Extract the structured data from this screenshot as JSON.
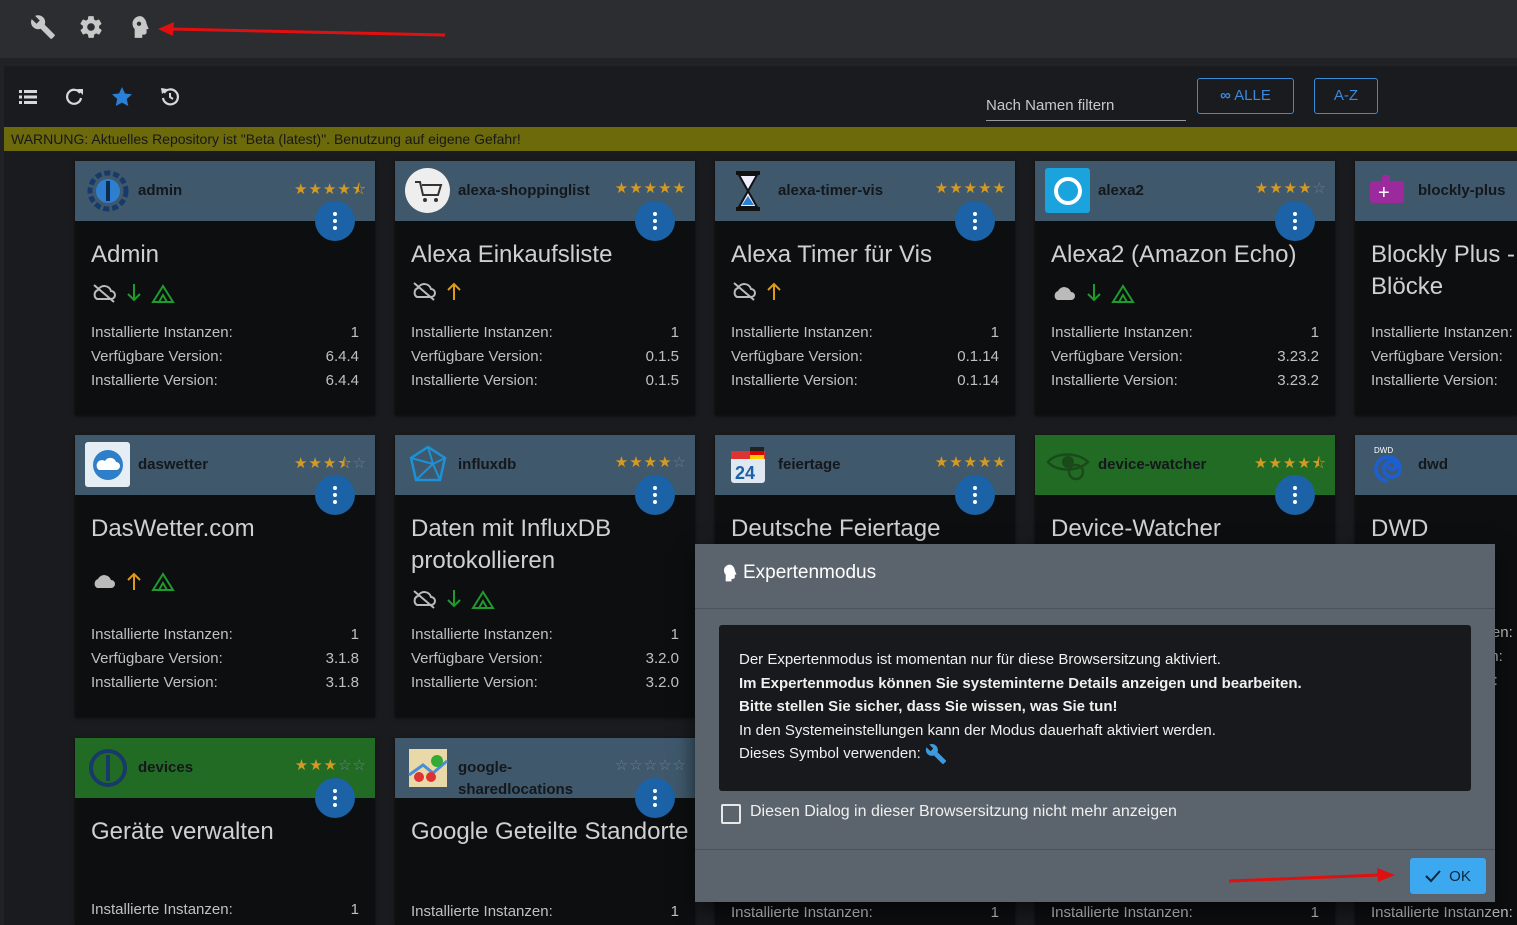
{
  "topbar": {
    "icons": [
      "wrench-icon",
      "gear-icon",
      "expert-head-icon"
    ]
  },
  "toolbar": {
    "icons": [
      "list-view-icon",
      "refresh-icon",
      "star-icon",
      "update-icon"
    ],
    "filter_placeholder": "Nach Namen filtern",
    "all_label": "ALLE",
    "az_label": "A-Z"
  },
  "warning": "WARNUNG: Aktuelles Repository ist \"Beta (latest)\". Benutzung auf eigene Gefahr!",
  "labels": {
    "instances": "Installierte Instanzen:",
    "available": "Verfügbare Version:",
    "installed": "Installierte Version:"
  },
  "cards": [
    {
      "name": "admin",
      "title": "Admin",
      "stars": "★★★★⯪",
      "instances": "1",
      "available": "6.4.4",
      "installed": "6.4.4"
    },
    {
      "name": "alexa-shoppinglist",
      "title": "Alexa Einkaufsliste",
      "stars": "★★★★★",
      "instances": "1",
      "available": "0.1.5",
      "installed": "0.1.5"
    },
    {
      "name": "alexa-timer-vis",
      "title": "Alexa Timer für Vis",
      "stars": "★★★★★",
      "instances": "1",
      "available": "0.1.14",
      "installed": "0.1.14"
    },
    {
      "name": "alexa2",
      "title": "Alexa2 (Amazon Echo)",
      "stars": "★★★★",
      "stars_off": "☆",
      "instances": "1",
      "available": "3.23.2",
      "installed": "3.23.2"
    },
    {
      "name": "blockly-plus",
      "title": "Blockly Plus - Blöcke",
      "stars": "",
      "instances": "",
      "available": "",
      "installed": ""
    },
    {
      "name": "daswetter",
      "title": "DasWetter.com",
      "stars": "★★★⯪",
      "stars_off": "☆",
      "instances": "1",
      "available": "3.1.8",
      "installed": "3.1.8"
    },
    {
      "name": "influxdb",
      "title": "Daten mit InfluxDB protokollieren",
      "stars": "★★★★",
      "stars_off": "☆",
      "instances": "1",
      "available": "3.2.0",
      "installed": "3.2.0"
    },
    {
      "name": "feiertage",
      "title": "Deutsche Feiertage",
      "stars": "★★★★★",
      "instances": "1"
    },
    {
      "name": "device-watcher",
      "title": "Device-Watcher",
      "stars": "★★★★⯪",
      "instances": "1"
    },
    {
      "name": "dwd",
      "title": "DWD",
      "stars": ""
    },
    {
      "name": "devices",
      "title": "Geräte verwalten",
      "stars": "★★★",
      "stars_off": "☆☆",
      "instances": "1"
    },
    {
      "name": "google-sharedlocations",
      "title": "Google Geteilte Standorte",
      "stars": "",
      "stars_off": "☆☆☆☆☆",
      "instances": "1"
    }
  ],
  "logos": {
    "admin": "io-admin-icon",
    "alexa-shoppinglist": "cart-icon",
    "alexa-timer-vis": "hourglass-icon",
    "alexa2": "alexa-ring-icon",
    "blockly-plus": "blockly-puzzle-icon",
    "daswetter": "cloud-logo-icon",
    "influxdb": "influx-cube-icon",
    "feiertage": "calendar-icon",
    "device-watcher": "eye-icon",
    "dwd": "dwd-swirl-icon",
    "devices": "io-devices-icon",
    "google-sharedlocations": "map-pins-icon"
  },
  "dialog": {
    "title": "Expertenmodus",
    "line1": "Der Expertenmodus ist momentan nur für diese Browsersitzung aktiviert.",
    "line2": "Im Expertenmodus können Sie systeminterne Details anzeigen und bearbeiten.",
    "line3": "Bitte stellen Sie sicher, dass Sie wissen, was Sie tun!",
    "line4": "In den Systemeinstellungen kann der Modus dauerhaft aktiviert werden.",
    "line5": "Dieses Symbol verwenden:",
    "checkbox_label": "Diesen Dialog in dieser Browsersitzung nicht mehr anzeigen",
    "ok_label": "OK"
  },
  "colors": {
    "accent": "#3ba8f0",
    "warning_bg": "#6d6a0c",
    "card_header": "#3f586b",
    "card_header_green": "#226b24",
    "star": "#d49a24"
  }
}
